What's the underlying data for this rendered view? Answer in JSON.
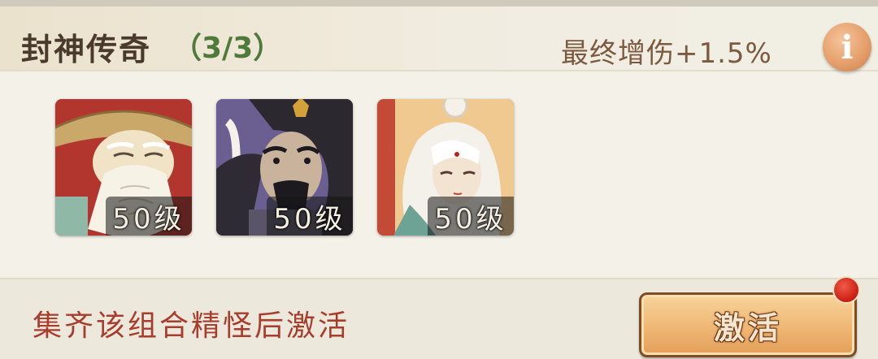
{
  "header": {
    "title": "封神传奇",
    "count": "（3/3）",
    "bonus": "最终增伤+1.5%",
    "info_icon": "info-icon",
    "info_glyph": "i"
  },
  "heroes": [
    {
      "portrait": "old-sage-with-straw-hat",
      "level": "50级"
    },
    {
      "portrait": "dark-haired-general",
      "level": "50级"
    },
    {
      "portrait": "white-haired-immortal",
      "level": "50级"
    }
  ],
  "footer": {
    "hint": "集齐该组合精怪后激活",
    "activate_label": "激活",
    "notification_dot_color": "#d2281b"
  },
  "colors": {
    "title": "#4a3a2d",
    "count": "#4f7a3a",
    "hint": "#a73d2d",
    "portrait_bg": "#b33a30"
  }
}
